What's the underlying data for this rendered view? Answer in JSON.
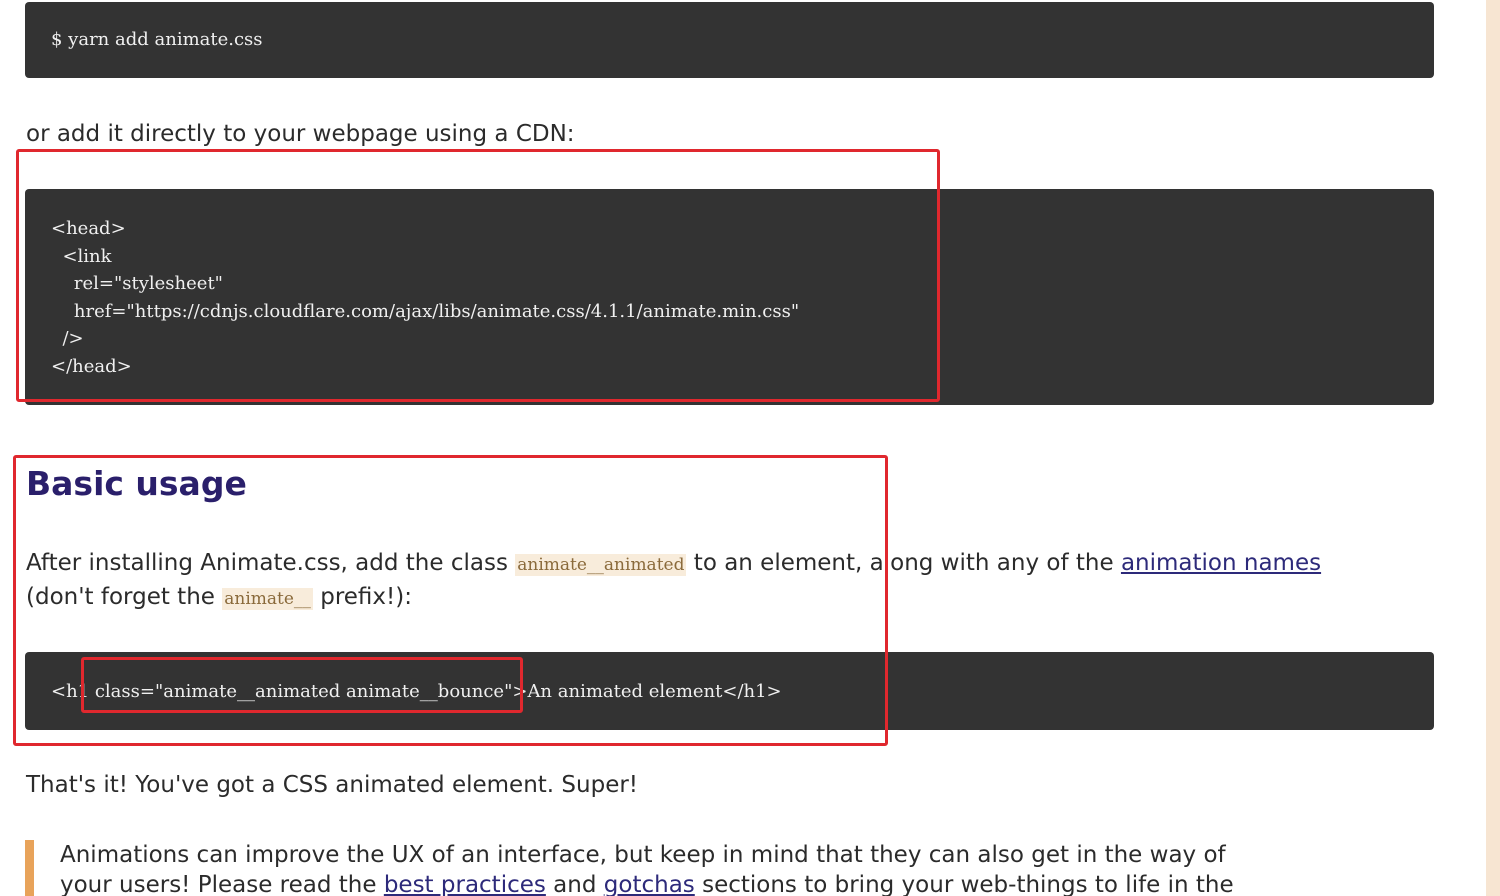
{
  "install": {
    "yarn_command": "$ yarn add animate.css",
    "cdn_intro": "or add it directly to your webpage using a CDN:",
    "cdn_code_lines": [
      "<head>",
      "  <link",
      "    rel=\"stylesheet\"",
      "    href=\"https://cdnjs.cloudflare.com/ajax/libs/animate.css/4.1.1/animate.min.css\"",
      "  />",
      "</head>"
    ]
  },
  "basic_usage": {
    "heading": "Basic usage",
    "line1_part1": "After installing Animate.css, add the class ",
    "line1_code": "animate__animated",
    "line1_part2": " to an element, along with any of the ",
    "line1_link": "animation names",
    "line2_part1": "(don't forget the ",
    "line2_code": "animate__",
    "line2_part2": " prefix!):",
    "example_code": "<h1 class=\"animate__animated animate__bounce\">An animated element</h1>",
    "done_text": "That's it! You've got a CSS animated element. Super!"
  },
  "note": {
    "line1": "Animations can improve the UX of an interface, but keep in mind that they can also get in the way of",
    "line2_part1": "your users! Please read the ",
    "line2_link1": "best practices",
    "line2_part2": " and ",
    "line2_link2": "gotchas",
    "line2_part3": " sections to bring your web-things to life in the"
  },
  "colors": {
    "code_background": "#333333",
    "heading": "#2a1f6b",
    "link": "#2d2a7a",
    "inline_code_background": "#f8ecdb",
    "note_border": "#e8a35a",
    "annotation_red": "#e0282e",
    "scrollbar_track": "#f7e5d2"
  }
}
